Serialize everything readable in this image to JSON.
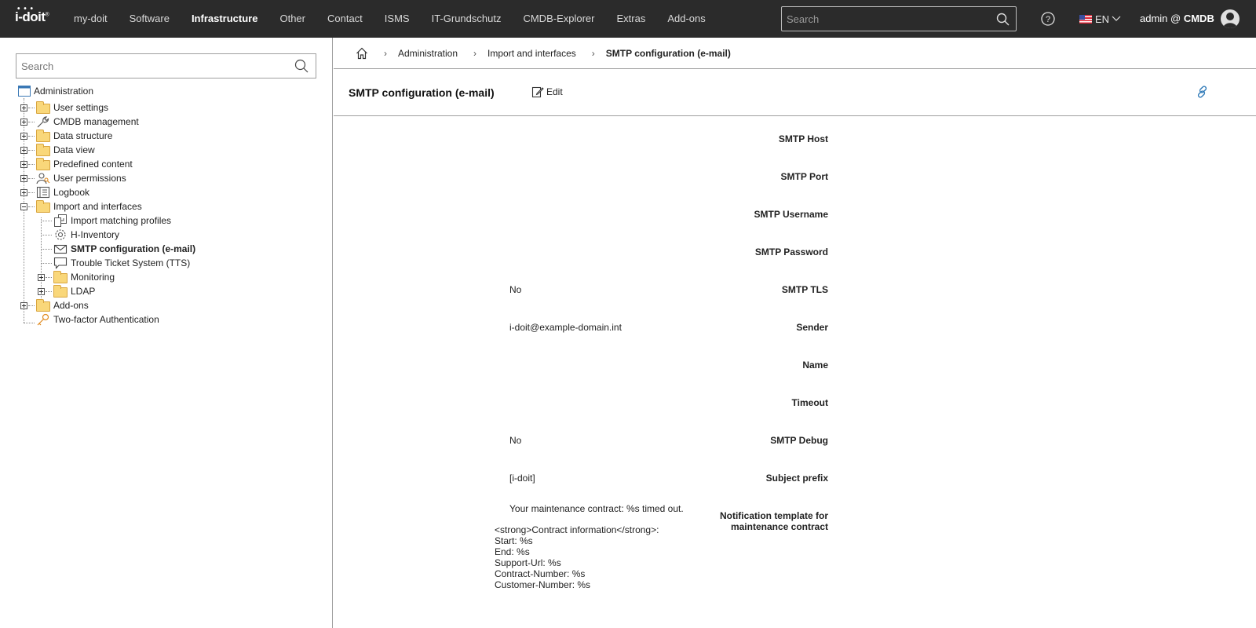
{
  "topbar": {
    "logo": "i-doit",
    "nav": [
      "my-doit",
      "Software",
      "Infrastructure",
      "Other",
      "Contact",
      "ISMS",
      "IT-Grundschutz",
      "CMDB-Explorer",
      "Extras",
      "Add-ons"
    ],
    "active_nav": "Infrastructure",
    "search_placeholder": "Search",
    "language": "EN",
    "user_prefix": "admin @",
    "user_db": "CMDB"
  },
  "sidebar": {
    "search_placeholder": "Search",
    "root": "Administration",
    "items": {
      "user_settings": "User settings",
      "cmdb_management": "CMDB management",
      "data_structure": "Data structure",
      "data_view": "Data view",
      "predefined_content": "Predefined content",
      "user_permissions": "User permissions",
      "logbook": "Logbook",
      "import_interfaces": "Import and interfaces",
      "import_matching": "Import matching profiles",
      "h_inventory": "H-Inventory",
      "smtp_config": "SMTP configuration (e-mail)",
      "tts": "Trouble Ticket System (TTS)",
      "monitoring": "Monitoring",
      "ldap": "LDAP",
      "addons": "Add-ons",
      "two_factor": "Two-factor Authentication"
    }
  },
  "breadcrumb": [
    "Administration",
    "Import and interfaces",
    "SMTP configuration (e-mail)"
  ],
  "main": {
    "title": "SMTP configuration (e-mail)",
    "edit_label": "Edit",
    "fields": {
      "smtp_host": {
        "label": "SMTP Host",
        "value": ""
      },
      "smtp_port": {
        "label": "SMTP Port",
        "value": ""
      },
      "smtp_username": {
        "label": "SMTP Username",
        "value": ""
      },
      "smtp_password": {
        "label": "SMTP Password",
        "value": ""
      },
      "smtp_tls": {
        "label": "SMTP TLS",
        "value": "No"
      },
      "sender": {
        "label": "Sender",
        "value": "i-doit@example-domain.int"
      },
      "name": {
        "label": "Name",
        "value": ""
      },
      "timeout": {
        "label": "Timeout",
        "value": ""
      },
      "smtp_debug": {
        "label": "SMTP Debug",
        "value": "No"
      },
      "subject_prefix": {
        "label": "Subject prefix",
        "value": "[i-doit]"
      },
      "notification_template": {
        "label_line1": "Notification template for",
        "label_line2": "maintenance contract",
        "first_line": "Your maintenance contract: %s timed out.",
        "body": "<strong>Contract information</strong>:\nStart: %s\nEnd: %s\nSupport-Url: %s\nContract-Number: %s\nCustomer-Number: %s"
      }
    }
  }
}
